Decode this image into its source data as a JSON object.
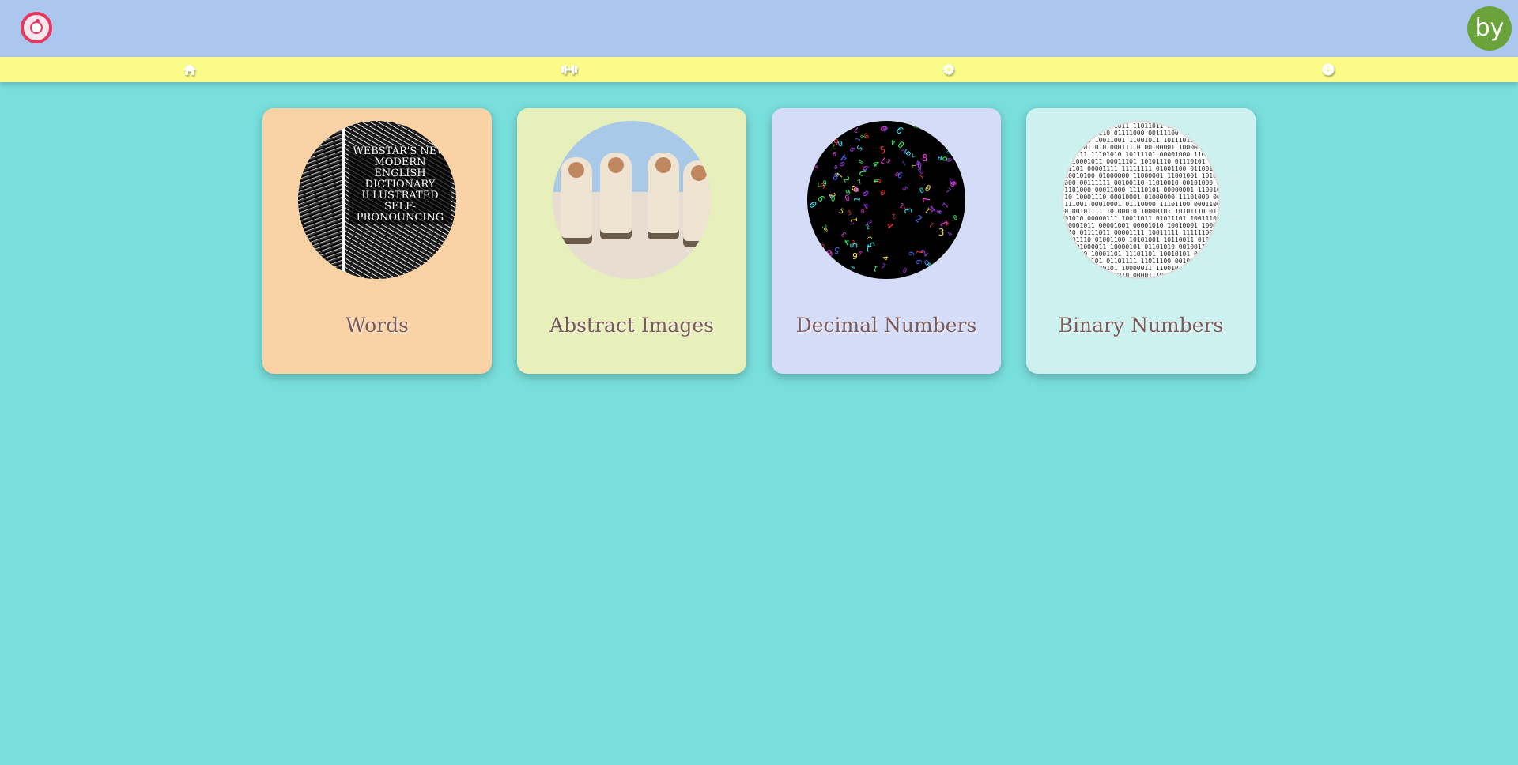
{
  "header": {
    "logo_icon": "app-logo-icon",
    "avatar_initials": "by",
    "avatar_color": "#6aa33a",
    "bar_color": "#abc7ef"
  },
  "nav": {
    "color": "#fbfb8a",
    "items": [
      {
        "icon": "home-icon"
      },
      {
        "icon": "dumbbell-icon"
      },
      {
        "icon": "gear-icon"
      },
      {
        "icon": "info-icon"
      }
    ]
  },
  "cards": [
    {
      "label": "Words",
      "color": "#f9d2a5",
      "image": "dictionary-book-image",
      "image_text": "WEBSTAR'S NEW MODERN ENGLISH DICTIONARY ILLUSTRATED SELF-PRONOUNCING"
    },
    {
      "label": "Abstract Images",
      "color": "#e7efba",
      "image": "astronauts-image"
    },
    {
      "label": "Decimal Numbers",
      "color": "#d4dcf8",
      "image": "colorful-digits-image"
    },
    {
      "label": "Binary Numbers",
      "color": "#cdf1ee",
      "image": "binary-sphere-image"
    }
  ]
}
